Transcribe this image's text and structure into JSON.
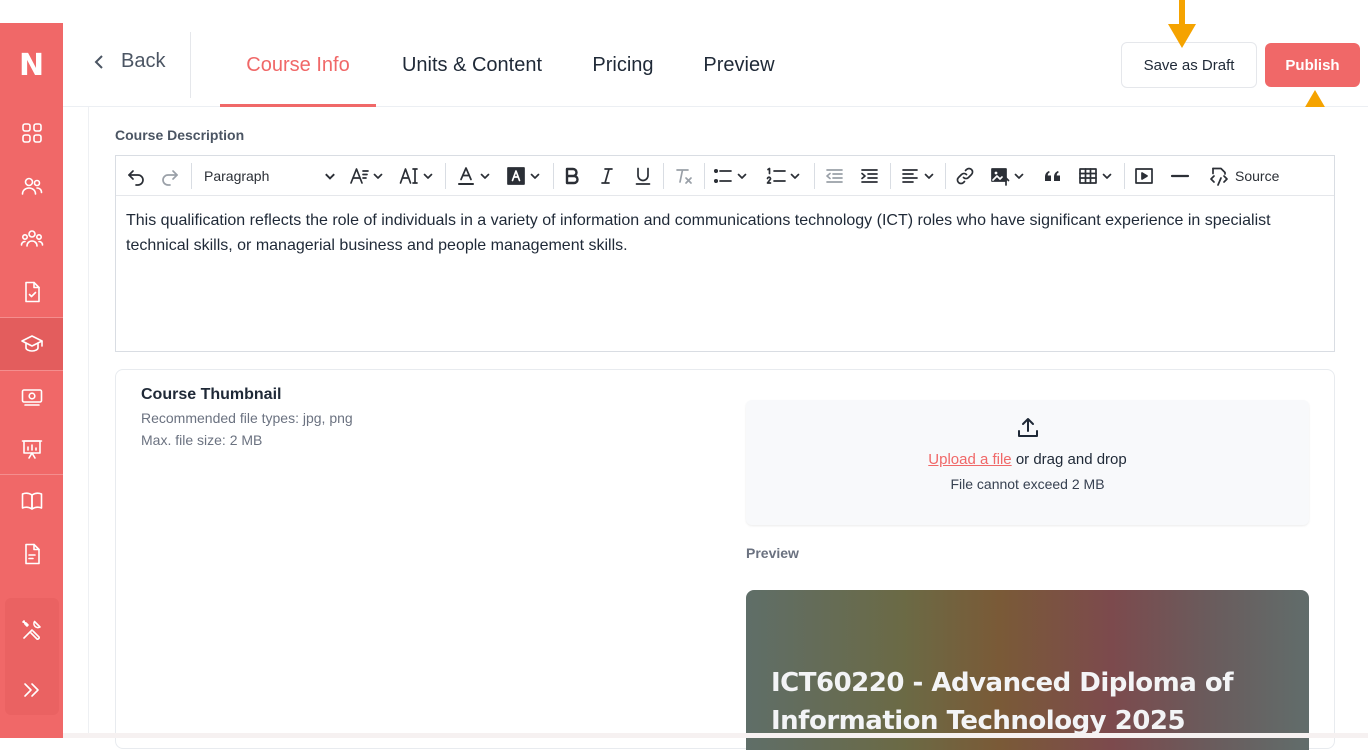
{
  "app": {
    "logo": "N",
    "brand_color": "#f06868"
  },
  "sidebar": {
    "items": [
      {
        "icon": "grid-icon"
      },
      {
        "icon": "users-icon"
      },
      {
        "icon": "group-icon"
      },
      {
        "icon": "document-check-icon"
      },
      {
        "icon": "graduation-cap-icon",
        "active": true
      },
      {
        "icon": "money-icon"
      },
      {
        "icon": "presentation-icon"
      },
      {
        "icon": "book-icon"
      },
      {
        "icon": "file-text-icon"
      },
      {
        "icon": "tools-icon"
      },
      {
        "icon": "expand-icon"
      }
    ]
  },
  "header": {
    "back_label": "Back",
    "tabs": [
      {
        "label": "Course Info",
        "active": true
      },
      {
        "label": "Units & Content"
      },
      {
        "label": "Pricing"
      },
      {
        "label": "Preview"
      }
    ],
    "save_draft_label": "Save as Draft",
    "publish_label": "Publish"
  },
  "description": {
    "label": "Course Description",
    "toolbar": {
      "paragraph_style": "Paragraph",
      "source_label": "Source"
    },
    "text": "This qualification reflects the role of individuals in a variety of information and communications technology (ICT) roles who have significant experience in specialist technical skills, or managerial business and people management skills."
  },
  "thumbnail": {
    "title": "Course Thumbnail",
    "file_types": "Recommended file types: jpg, png",
    "max_size": "Max. file size: 2 MB",
    "upload_link": "Upload a file",
    "drag_text": " or drag and drop",
    "limit_text": "File cannot exceed 2 MB",
    "preview_label": "Preview",
    "preview_title": "ICT60220 - Advanced Diploma of Information Technology 2025"
  }
}
